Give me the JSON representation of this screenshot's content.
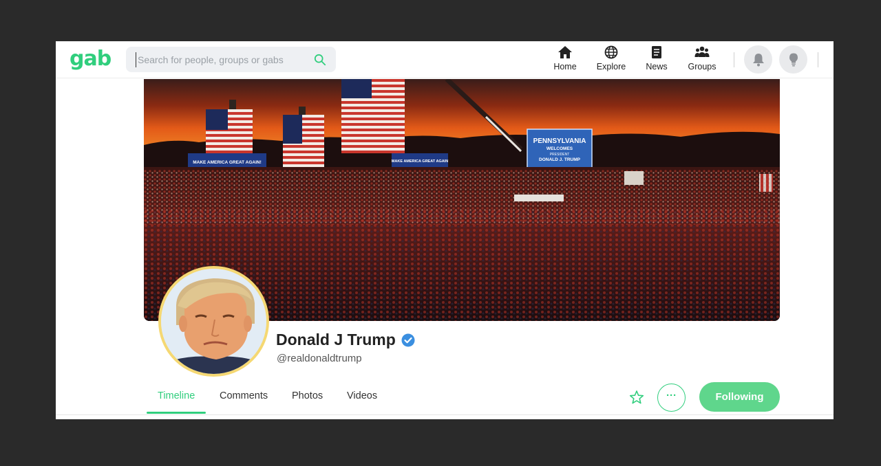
{
  "header": {
    "logo": "gab",
    "search_placeholder": "Search for people, groups or gabs",
    "nav": [
      {
        "label": "Home",
        "icon": "home-icon"
      },
      {
        "label": "Explore",
        "icon": "globe-icon"
      },
      {
        "label": "News",
        "icon": "document-icon"
      },
      {
        "label": "Groups",
        "icon": "group-icon"
      }
    ],
    "actions": [
      "bell-icon",
      "lightbulb-icon"
    ]
  },
  "cover": {
    "banner_left": "MAKE AMERICA GREAT AGAIN!",
    "banner_mid": "MAKE AMERICA GREAT AGAIN",
    "sign_lines": [
      "PENNSYLVANIA",
      "WELCOMES",
      "PRESIDENT",
      "DONALD J. TRUMP"
    ]
  },
  "profile": {
    "name": "Donald J Trump",
    "handle": "@realdonaldtrump",
    "verified": true
  },
  "tabs": [
    {
      "label": "Timeline",
      "active": true
    },
    {
      "label": "Comments",
      "active": false
    },
    {
      "label": "Photos",
      "active": false
    },
    {
      "label": "Videos",
      "active": false
    }
  ],
  "actions": {
    "more_label": "···",
    "follow_label": "Following"
  },
  "colors": {
    "brand": "#30ce7d",
    "follow_button": "#5fd68c",
    "verified": "#3b8fe0",
    "avatar_ring": "#f5d873"
  }
}
